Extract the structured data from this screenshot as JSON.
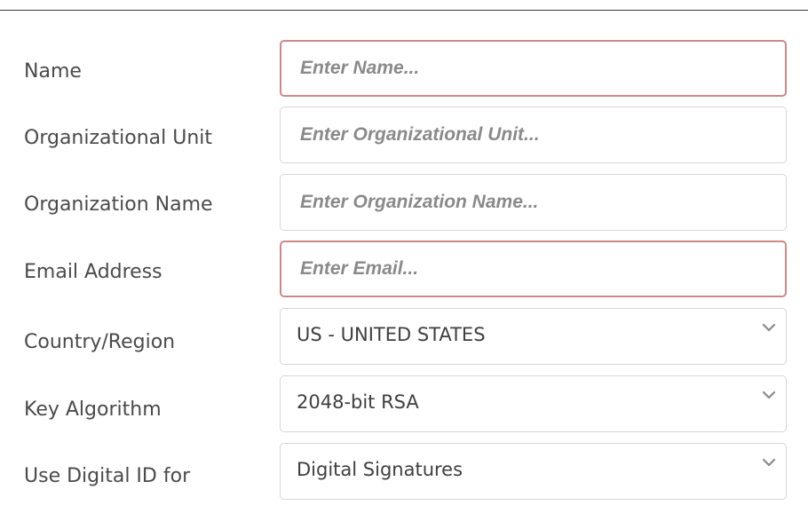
{
  "form": {
    "name": {
      "label": "Name",
      "placeholder": "Enter Name..."
    },
    "org_unit": {
      "label": "Organizational Unit",
      "placeholder": "Enter Organizational Unit..."
    },
    "org_name": {
      "label": "Organization Name",
      "placeholder": "Enter Organization Name..."
    },
    "email": {
      "label": "Email Address",
      "placeholder": "Enter Email..."
    },
    "country": {
      "label": "Country/Region",
      "value": "US - UNITED STATES",
      "icon": "chevron-down-icon"
    },
    "key_algorithm": {
      "label": "Key Algorithm",
      "value": "2048-bit RSA",
      "icon": "chevron-down-icon"
    },
    "use_for": {
      "label": "Use Digital ID for",
      "value": "Digital Signatures",
      "icon": "chevron-down-icon"
    }
  },
  "colors": {
    "error_border": "#cf8888",
    "field_border": "#d6d6d6",
    "label_text": "#4a4a4a"
  }
}
